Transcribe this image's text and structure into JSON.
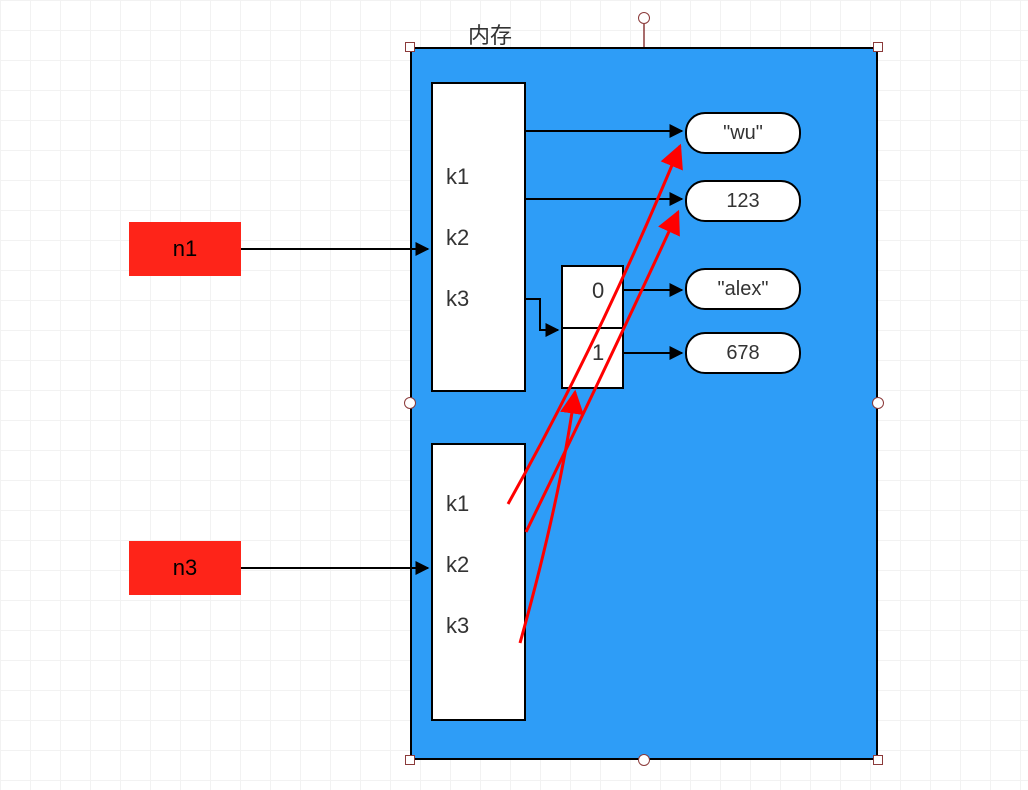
{
  "title": "内存",
  "variables": {
    "n1": "n1",
    "n3": "n3"
  },
  "dict1": {
    "k1": "k1",
    "k2": "k2",
    "k3": "k3"
  },
  "dict2": {
    "k1": "k1",
    "k2": "k2",
    "k3": "k3"
  },
  "list": {
    "idx0": "0",
    "idx1": "1"
  },
  "values": {
    "wu": "\"wu\"",
    "v123": "123",
    "alex": "\"alex\"",
    "v678": "678"
  }
}
